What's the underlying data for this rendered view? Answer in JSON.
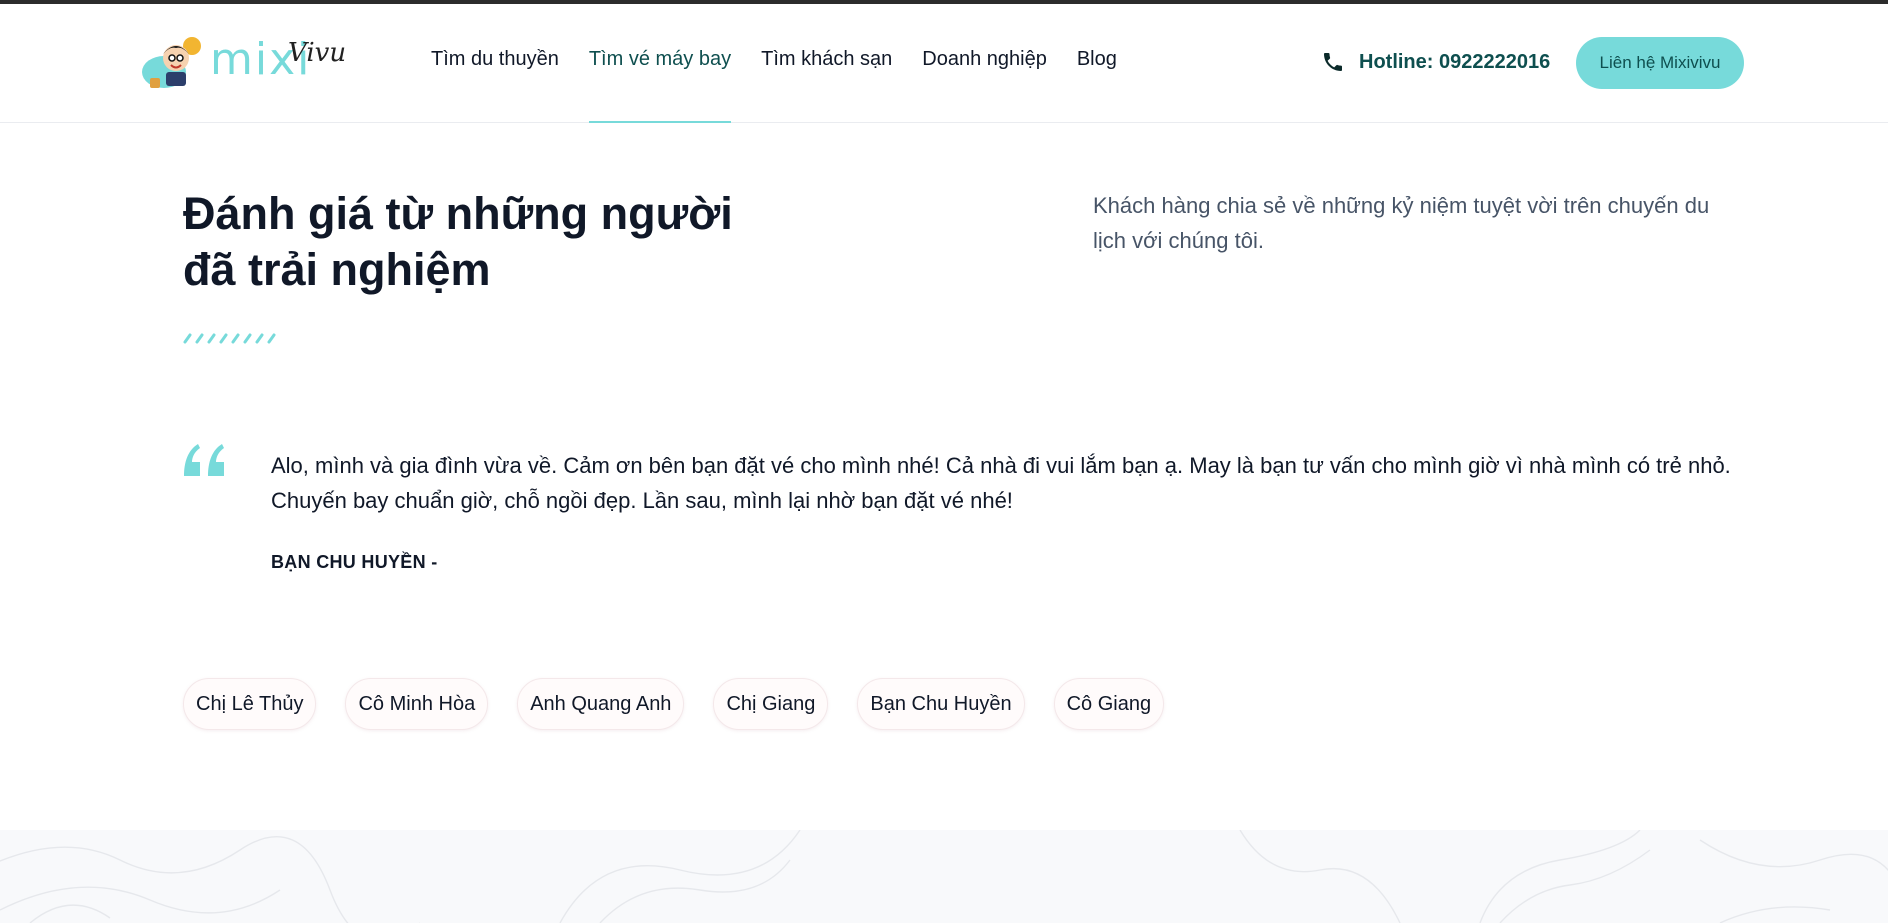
{
  "header": {
    "logo_brand": "mixi",
    "logo_script": "Vivu",
    "nav": [
      {
        "label": "Tìm du thuyền",
        "active": false
      },
      {
        "label": "Tìm vé máy bay",
        "active": true
      },
      {
        "label": "Tìm khách sạn",
        "active": false
      },
      {
        "label": "Doanh nghiệp",
        "active": false
      },
      {
        "label": "Blog",
        "active": false
      }
    ],
    "hotline_icon": "phone-icon",
    "hotline": "Hotline: 0922222016",
    "cta_label": "Liên hệ Mixivivu"
  },
  "section": {
    "title": "Đánh giá từ những người đã trải nghiệm",
    "subtitle": "Khách hàng chia sẻ về những kỷ niệm tuyệt vời trên chuyến du lịch với chúng tôi.",
    "quote_icon": "quote-icon",
    "quote": "Alo, mình và gia đình vừa về. Cảm ơn bên bạn đặt vé cho mình nhé! Cả nhà đi vui lắm bạn ạ. May là bạn tư vấn cho mình giờ vì nhà mình có trẻ nhỏ. Chuyến bay chuẩn giờ, chỗ ngồi đẹp. Lần sau, mình lại nhờ bạn đặt vé nhé!",
    "author": "BẠN CHU HUYỀN -",
    "reviewers": [
      "Chị Lê Thủy",
      "Cô Minh Hòa",
      "Anh Quang Anh",
      "Chị Giang",
      "Bạn Chu Huyền",
      "Cô Giang"
    ]
  },
  "colors": {
    "accent": "#77dada",
    "accent_dark": "#0e4f4f",
    "text": "#101828",
    "muted": "#475467"
  }
}
